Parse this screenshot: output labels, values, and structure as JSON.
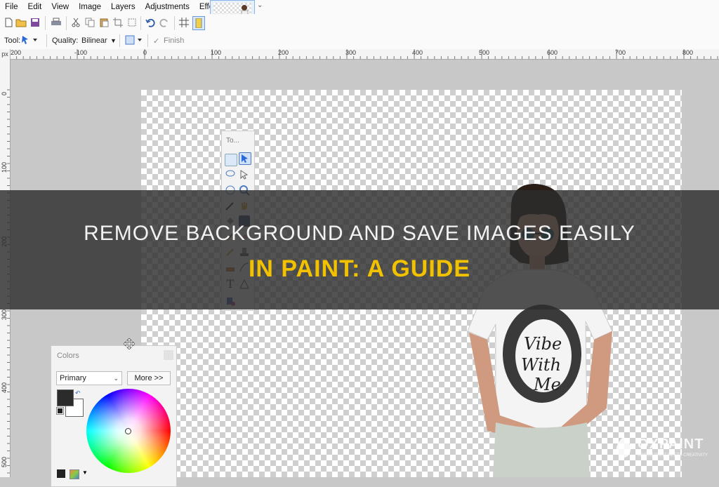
{
  "menu": {
    "items": [
      "File",
      "Edit",
      "View",
      "Image",
      "Layers",
      "Adjustments",
      "Effects"
    ]
  },
  "toolbar": {
    "tool_label": "Tool:",
    "quality_label": "Quality:",
    "quality_value": "Bilinear",
    "finish_label": "Finish"
  },
  "ruler": {
    "unit": "px",
    "horizontal_labels": [
      "200",
      "-100",
      "0",
      "100",
      "200",
      "300",
      "400",
      "500",
      "600",
      "700",
      "800"
    ],
    "vertical_labels": [
      "0",
      "100",
      "200",
      "300",
      "400",
      "500"
    ]
  },
  "tools_panel": {
    "title": "To..."
  },
  "colors_panel": {
    "title": "Colors",
    "mode": "Primary",
    "more_button": "More >>",
    "primary_color": "#2b2b2b",
    "secondary_color": "#ffffff"
  },
  "overlay": {
    "line1": "REMOVE BACKGROUND AND SAVE IMAGES EASILY",
    "line2": "IN PAINT: A GUIDE"
  },
  "photo": {
    "shirt_text": "Vibe With Me"
  },
  "watermark": {
    "name": "OXPAINT",
    "tagline": "WHERE PAINT MEETS CREATIVITY"
  },
  "colors": {
    "accent": "#f2c200",
    "selection": "#8ab4e8"
  }
}
